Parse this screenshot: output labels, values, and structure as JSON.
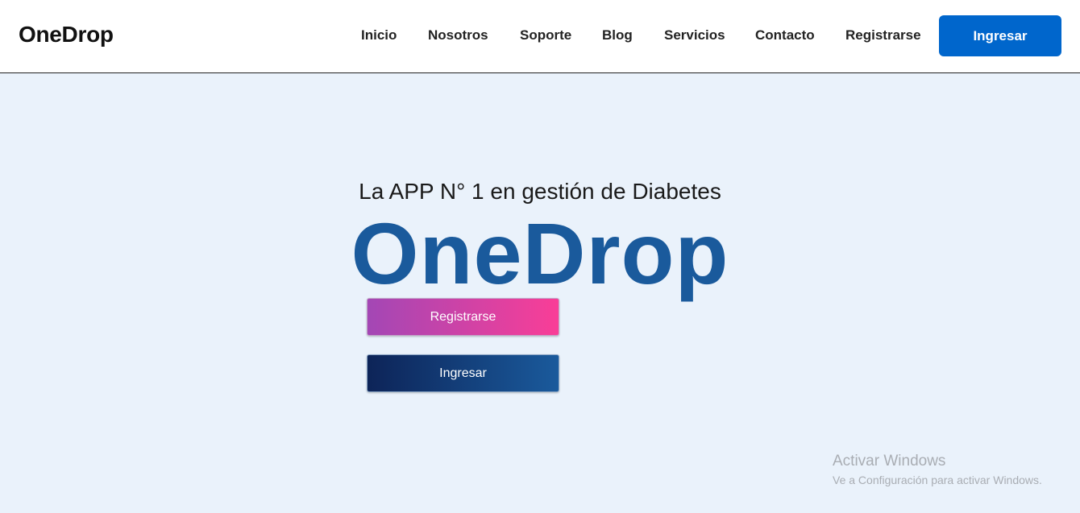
{
  "header": {
    "brand": "OneDrop",
    "nav": [
      {
        "label": "Inicio"
      },
      {
        "label": "Nosotros"
      },
      {
        "label": "Soporte"
      },
      {
        "label": "Blog"
      },
      {
        "label": "Servicios"
      },
      {
        "label": "Contacto"
      },
      {
        "label": "Registrarse"
      }
    ],
    "cta_label": "Ingresar"
  },
  "hero": {
    "tagline": "La APP N° 1 en gestión de Diabetes",
    "title": "OneDrop",
    "register_label": "Registrarse",
    "login_label": "Ingresar"
  },
  "watermark": {
    "title": "Activar Windows",
    "subtitle": "Ve a Configuración para activar Windows."
  },
  "colors": {
    "primary": "#0066cc",
    "title_blue": "#1a5a9c",
    "background": "#eaf2fb",
    "register_gradient_start": "#a347b5",
    "register_gradient_end": "#f93e97",
    "login_gradient_start": "#0d2458",
    "login_gradient_end": "#1a5a9c"
  }
}
